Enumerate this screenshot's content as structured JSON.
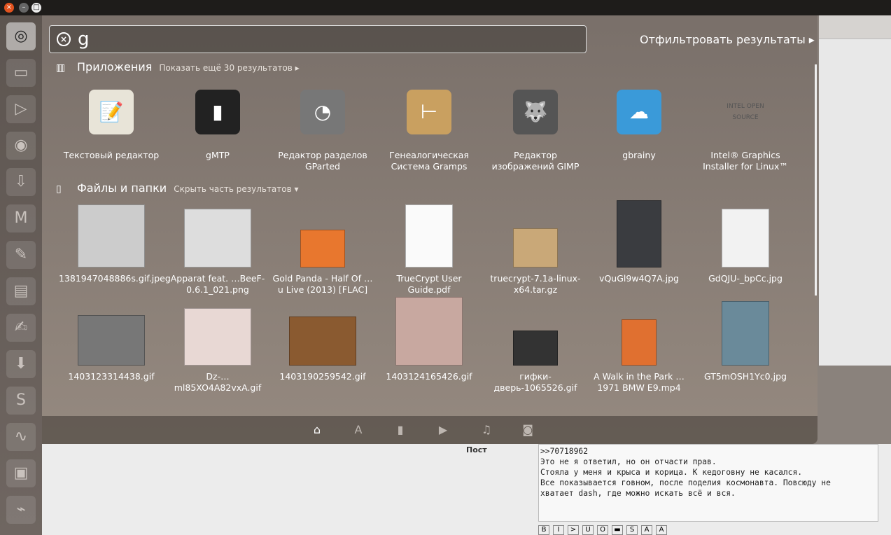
{
  "window_buttons": {
    "close": "×",
    "minimize": "–",
    "maximize": "□"
  },
  "launcher": [
    {
      "name": "ubuntu-dash-icon",
      "glyph": "◎"
    },
    {
      "name": "file-cabinet-icon",
      "glyph": "▭"
    },
    {
      "name": "media-player-icon",
      "glyph": "▷"
    },
    {
      "name": "firefox-icon",
      "glyph": "◉"
    },
    {
      "name": "installer-icon",
      "glyph": "⇩"
    },
    {
      "name": "tux-app-icon",
      "glyph": "M"
    },
    {
      "name": "edit-app-icon",
      "glyph": "✎"
    },
    {
      "name": "writer-icon",
      "glyph": "▤"
    },
    {
      "name": "text-editor-icon",
      "glyph": "✍"
    },
    {
      "name": "download-icon",
      "glyph": "⬇"
    },
    {
      "name": "skype-icon",
      "glyph": "S"
    },
    {
      "name": "system-monitor-icon",
      "glyph": "∿"
    },
    {
      "name": "image-viewer-icon",
      "glyph": "▣"
    },
    {
      "name": "activity-monitor-icon",
      "glyph": "⌁"
    }
  ],
  "search": {
    "value": "g",
    "clear_icon": "⊗"
  },
  "filter_label": "Отфильтровать результаты ▸",
  "apps": {
    "title": "Приложения",
    "more": "Показать ещё 30 результатов ▸",
    "items": [
      {
        "label": "Текстовый редактор",
        "color": "#e8e4d8",
        "glyph": "📝"
      },
      {
        "label": "gMTP",
        "color": "#222",
        "glyph": "▮"
      },
      {
        "label": "Редактор разделов GParted",
        "color": "#777",
        "glyph": "◔"
      },
      {
        "label": "Генеалогическая Система Gramps",
        "color": "#c9a060",
        "glyph": "⊢"
      },
      {
        "label": "Редактор изображений GIMP",
        "color": "#555",
        "glyph": "🐺"
      },
      {
        "label": "gbrainy",
        "color": "#3a9ad9",
        "glyph": "☁"
      },
      {
        "label": "Intel® Graphics Installer for Linux™",
        "color": "transparent",
        "glyph": "INTEL OPEN SOURCE"
      }
    ]
  },
  "files": {
    "title": "Файлы и папки",
    "more": "Скрыть часть результатов ▾",
    "items": [
      {
        "label": "1381947048886s.gif.jpeg",
        "color": "#ccc"
      },
      {
        "label": "Apparat feat. …BeeF-0.6.1_021.png",
        "color": "#ddd"
      },
      {
        "label": "Gold Panda - Half Of …u Live (2013) [FLAC]",
        "color": "#e8772e"
      },
      {
        "label": "TrueCrypt User Guide.pdf",
        "color": "#fafafa"
      },
      {
        "label": "truecrypt-7.1a-linux-x64.tar.gz",
        "color": "#c9a878"
      },
      {
        "label": "vQuGl9w4Q7A.jpg",
        "color": "#3a3c40"
      },
      {
        "label": "GdQJU-_bpCc.jpg",
        "color": "#f2f2f2"
      },
      {
        "label": "1403123314438.gif",
        "color": "#777"
      },
      {
        "label": "Dz-…ml85XO4A82vxA.gif",
        "color": "#e8d8d4"
      },
      {
        "label": "1403190259542.gif",
        "color": "#8a5a30"
      },
      {
        "label": "1403124165426.gif",
        "color": "#c8a8a0"
      },
      {
        "label": "гифки-дверь-1065526.gif",
        "color": "#333"
      },
      {
        "label": "A Walk in the Park … 1971 BMW E9.mp4",
        "color": "#e07030"
      },
      {
        "label": "GT5mOSH1Yc0.jpg",
        "color": "#6a8a9a"
      }
    ]
  },
  "lenses": [
    {
      "name": "home-lens-icon",
      "glyph": "⌂"
    },
    {
      "name": "apps-lens-icon",
      "glyph": "A"
    },
    {
      "name": "files-lens-icon",
      "glyph": "▮"
    },
    {
      "name": "video-lens-icon",
      "glyph": "▶"
    },
    {
      "name": "music-lens-icon",
      "glyph": "♫"
    },
    {
      "name": "photo-lens-icon",
      "glyph": "◙"
    }
  ],
  "post": {
    "label": "Пост",
    "text": ">>70718962\nЭто не я ответил, но он отчасти прав.\nСтояла у меня и крыса и корица. К кедоговну не касался.\nВсе показывается говном, после поделия космонавта. Повсюду не\nхватает dash, где можно искать всё и вся.",
    "format_buttons": [
      "B",
      "I",
      ">",
      "U",
      "O",
      "▬",
      "S",
      "A",
      "A"
    ]
  }
}
